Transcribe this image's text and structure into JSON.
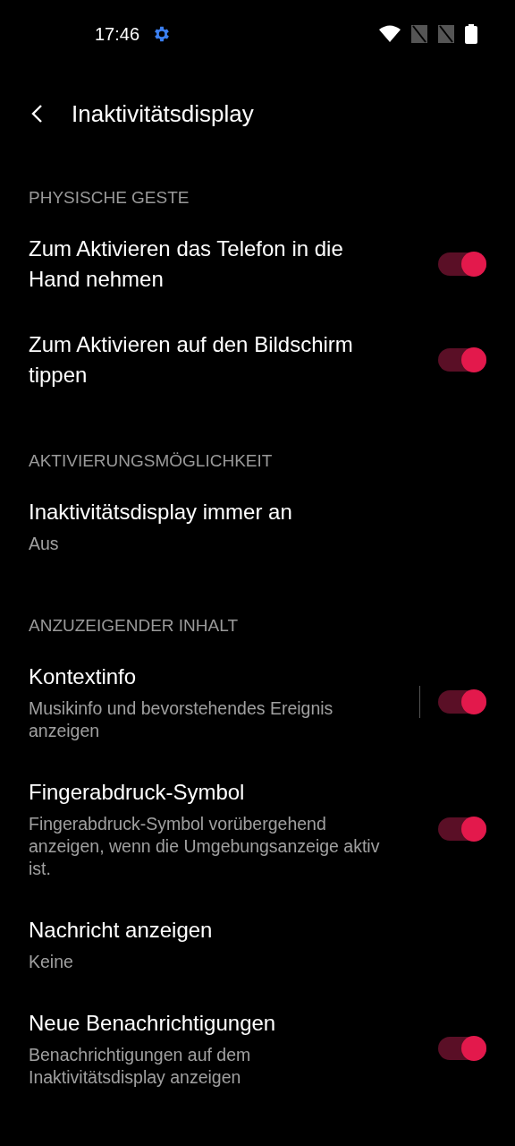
{
  "status_bar": {
    "time": "17:46"
  },
  "toolbar": {
    "title": "Inaktivitätsdisplay"
  },
  "sections": [
    {
      "header": "PHYSISCHE GESTE",
      "items": [
        {
          "kind": "switch",
          "title": "Zum Aktivieren das Telefon in die Hand nehmen",
          "on": true,
          "separator": false
        },
        {
          "kind": "switch",
          "title": "Zum Aktivieren auf den Bildschirm tippen",
          "on": true,
          "separator": false
        }
      ]
    },
    {
      "header": "AKTIVIERUNGSMÖGLICHKEIT",
      "items": [
        {
          "kind": "text",
          "title": "Inaktivitätsdisplay immer an",
          "summary": "Aus"
        }
      ]
    },
    {
      "header": "ANZUZEIGENDER INHALT",
      "items": [
        {
          "kind": "switch",
          "title": "Kontextinfo",
          "summary": "Musikinfo und bevorstehendes Ereignis anzeigen",
          "on": true,
          "separator": true
        },
        {
          "kind": "switch",
          "title": "Fingerabdruck-Symbol",
          "summary": "Fingerabdruck-Symbol vorübergehend anzeigen, wenn die Umgebungsanzeige aktiv ist.",
          "on": true,
          "separator": false
        },
        {
          "kind": "text",
          "title": "Nachricht anzeigen",
          "summary": "Keine"
        },
        {
          "kind": "switch",
          "title": "Neue Benachrichtigungen",
          "summary": "Benachrichtigungen auf dem Inaktivitätsdisplay anzeigen",
          "on": true,
          "separator": false
        }
      ]
    }
  ]
}
